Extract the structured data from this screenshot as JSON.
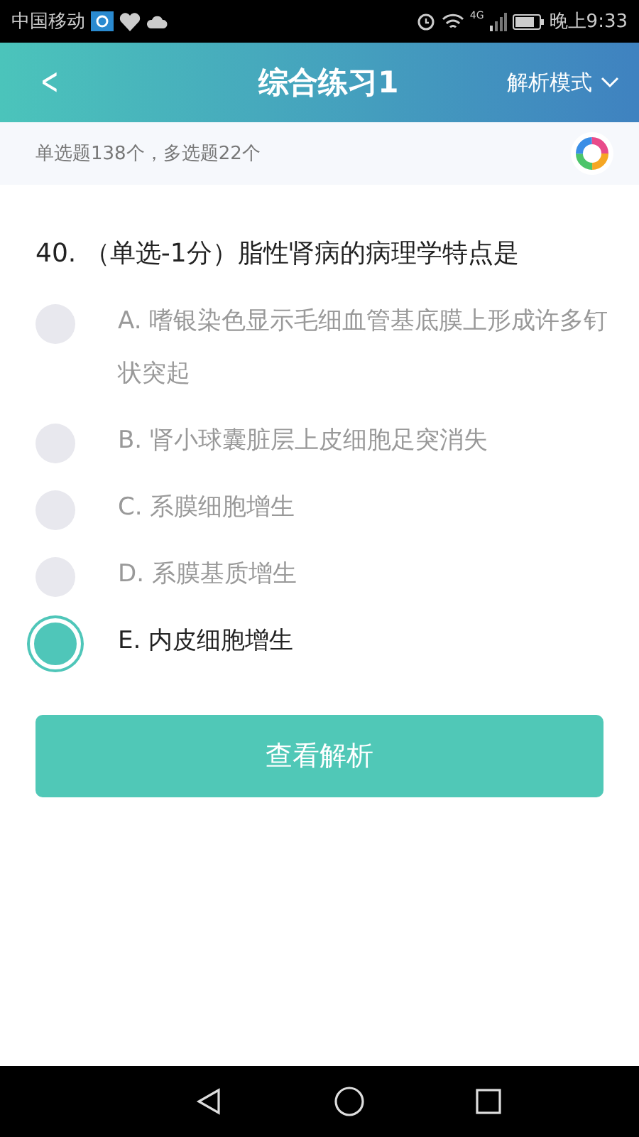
{
  "status_bar": {
    "carrier": "中国移动",
    "network": "4G",
    "time": "晚上9:33"
  },
  "header": {
    "back": "<",
    "title": "综合练习1",
    "mode": "解析模式"
  },
  "summary": "单选题138个，多选题22个",
  "question": {
    "text": "40. （单选-1分）脂性肾病的病理学特点是",
    "options": [
      {
        "text": "A. 嗜银染色显示毛细血管基底膜上形成许多钉状突起",
        "selected": false
      },
      {
        "text": "B. 肾小球囊脏层上皮细胞足突消失",
        "selected": false
      },
      {
        "text": "C. 系膜细胞增生",
        "selected": false
      },
      {
        "text": "D. 系膜基质增生",
        "selected": false
      },
      {
        "text": "E. 内皮细胞增生",
        "selected": true
      }
    ]
  },
  "action": "查看解析"
}
